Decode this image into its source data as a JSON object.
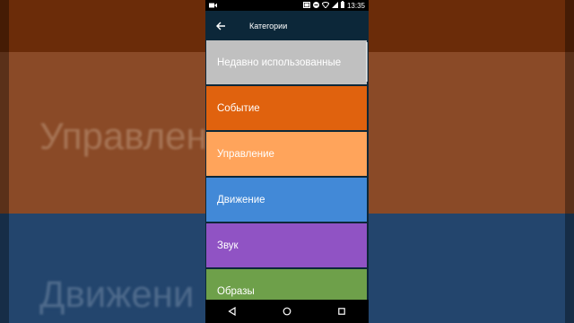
{
  "background": {
    "text_top": "Управлен",
    "text_bottom": "Движени"
  },
  "statusbar": {
    "time": "13:35"
  },
  "appbar": {
    "title": "Категории"
  },
  "categories": [
    {
      "label": "Недавно использованные",
      "color": "#c0c0c0"
    },
    {
      "label": "Событие",
      "color": "#e0620e"
    },
    {
      "label": "Управление",
      "color": "#ffa45b"
    },
    {
      "label": "Движение",
      "color": "#4289d7"
    },
    {
      "label": "Звук",
      "color": "#9053c4"
    },
    {
      "label": "Образы",
      "color": "#6ea04a"
    }
  ],
  "icons": {
    "status_left": "video-camera-icon",
    "status_right": [
      "cast-icon",
      "do-not-disturb-icon",
      "wifi-icon",
      "cellular-icon",
      "battery-icon"
    ],
    "appbar": "back-arrow-icon",
    "nav": [
      "back-triangle-icon",
      "home-circle-icon",
      "recents-square-icon"
    ]
  }
}
